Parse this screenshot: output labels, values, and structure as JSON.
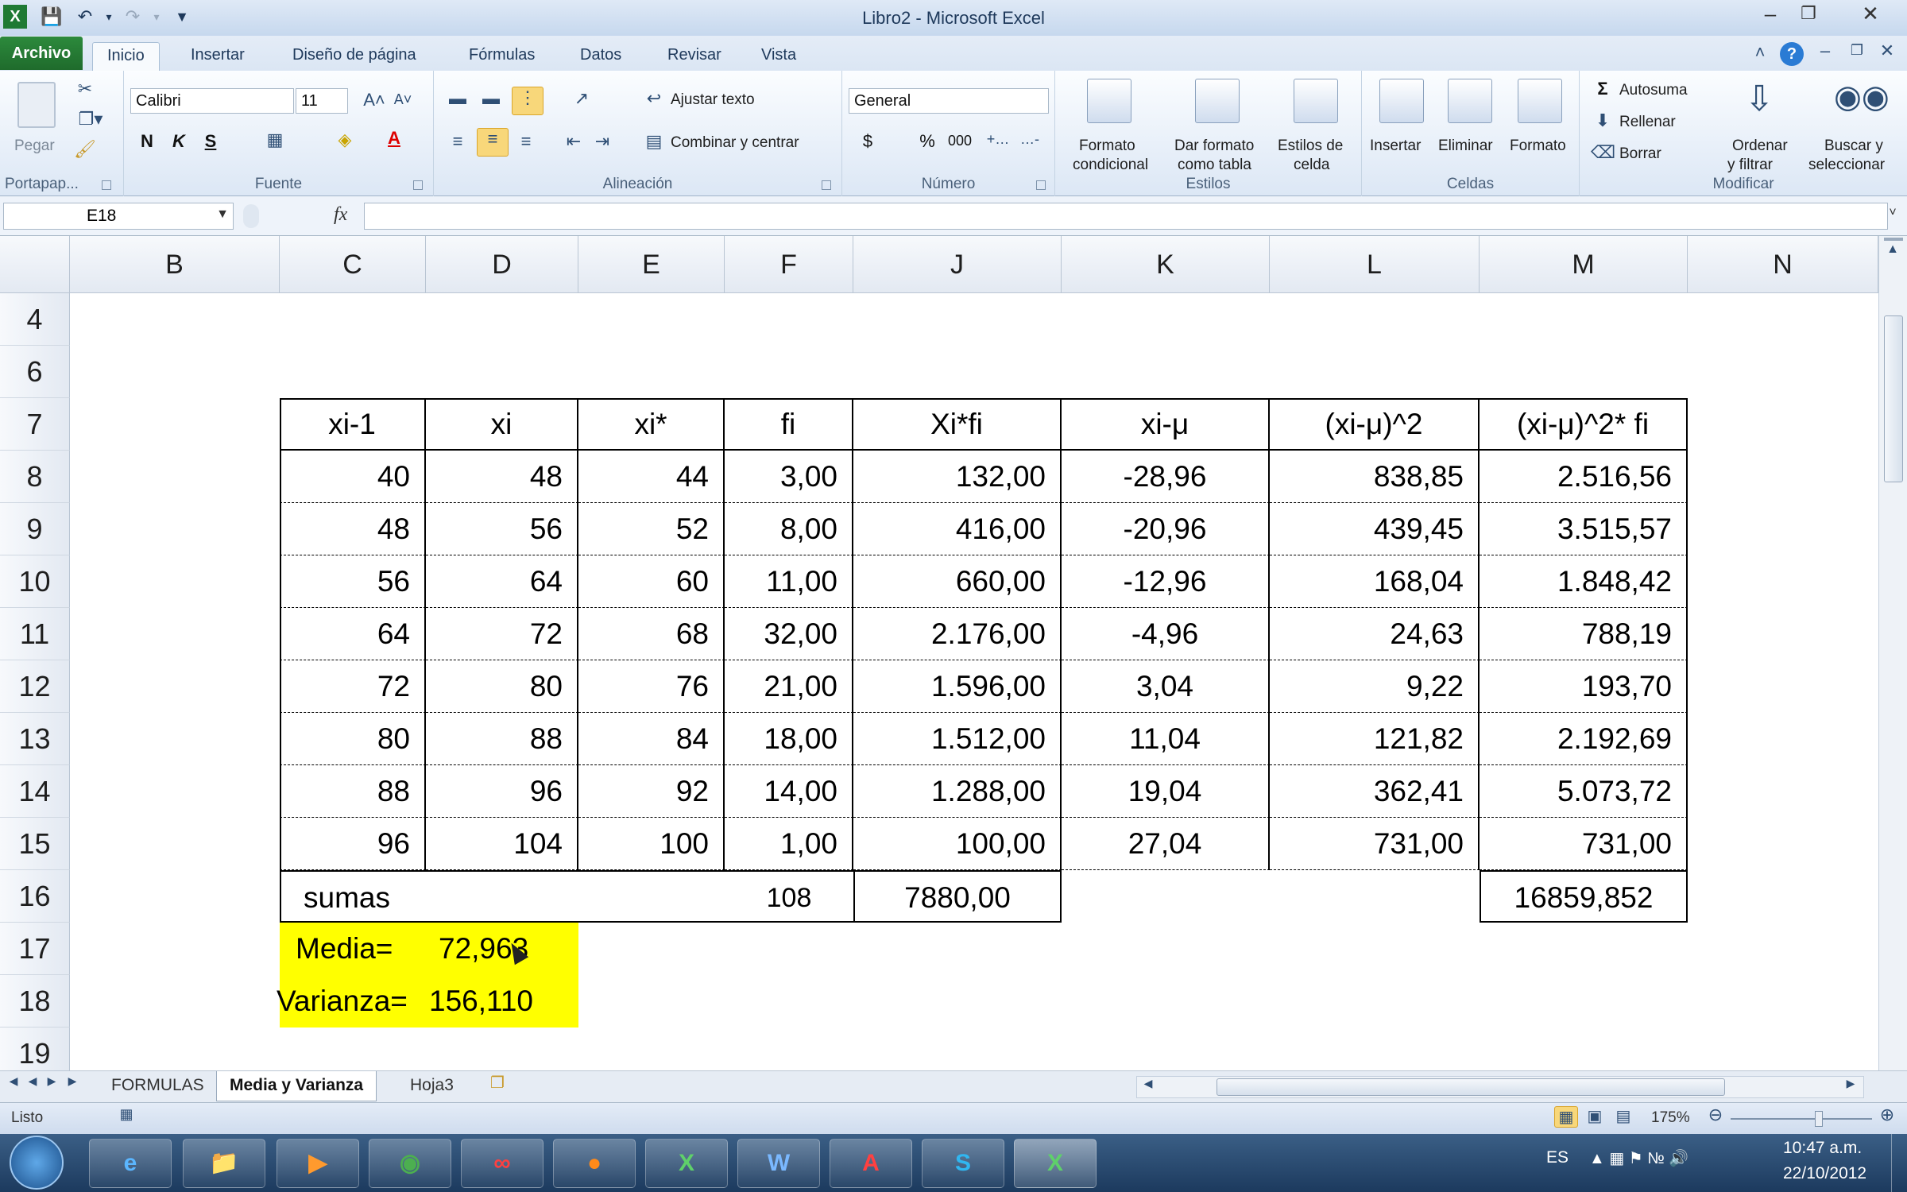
{
  "window": {
    "title": "Libro2  -  Microsoft Excel",
    "quick_access": [
      "save-icon",
      "undo-icon",
      "redo-icon",
      "customize-icon"
    ]
  },
  "menu_tabs": [
    "Archivo",
    "Inicio",
    "Insertar",
    "Diseño de página",
    "Fórmulas",
    "Datos",
    "Revisar",
    "Vista"
  ],
  "ribbon": {
    "clipboard": {
      "paste": "Pegar",
      "label": "Portapap..."
    },
    "font": {
      "name": "Calibri",
      "size": "11",
      "label": "Fuente",
      "bold": "N",
      "italic": "K",
      "underline": "S"
    },
    "alignment": {
      "wrap": "Ajustar texto",
      "merge": "Combinar y centrar",
      "label": "Alineación"
    },
    "number": {
      "format": "General",
      "currency": "$",
      "percent": "%",
      "thousands": "000",
      "label": "Número"
    },
    "styles": {
      "cond": [
        "Formato",
        "condicional"
      ],
      "table": [
        "Dar formato",
        "como tabla"
      ],
      "cell": [
        "Estilos de",
        "celda"
      ],
      "label": "Estilos"
    },
    "cells": {
      "insert": "Insertar",
      "delete": "Eliminar",
      "format": "Formato",
      "label": "Celdas"
    },
    "editing": {
      "autosum": "Autosuma",
      "fill": "Rellenar",
      "clear": "Borrar",
      "sort": [
        "Ordenar",
        "y filtrar"
      ],
      "find": [
        "Buscar y",
        "seleccionar"
      ],
      "label": "Modificar"
    }
  },
  "formula_bar": {
    "name_box": "E18",
    "fx": "fx",
    "formula": ""
  },
  "columns": [
    "B",
    "C",
    "D",
    "E",
    "F",
    "J",
    "K",
    "L",
    "M",
    "N"
  ],
  "rows": [
    "4",
    "6",
    "7",
    "8",
    "9",
    "10",
    "11",
    "12",
    "13",
    "14",
    "15",
    "16",
    "17",
    "18",
    "19"
  ],
  "table": {
    "headers": [
      "xi-1",
      "xi",
      "xi*",
      "fi",
      "Xi*fi",
      "xi-μ",
      "(xi-μ)^2",
      "(xi-μ)^2*    fi"
    ],
    "body": [
      [
        "40",
        "48",
        "44",
        "3,00",
        "132,00",
        "-28,96",
        "838,85",
        "2.516,56"
      ],
      [
        "48",
        "56",
        "52",
        "8,00",
        "416,00",
        "-20,96",
        "439,45",
        "3.515,57"
      ],
      [
        "56",
        "64",
        "60",
        "11,00",
        "660,00",
        "-12,96",
        "168,04",
        "1.848,42"
      ],
      [
        "64",
        "72",
        "68",
        "32,00",
        "2.176,00",
        "-4,96",
        "24,63",
        "788,19"
      ],
      [
        "72",
        "80",
        "76",
        "21,00",
        "1.596,00",
        "3,04",
        "9,22",
        "193,70"
      ],
      [
        "80",
        "88",
        "84",
        "18,00",
        "1.512,00",
        "11,04",
        "121,82",
        "2.192,69"
      ],
      [
        "88",
        "96",
        "92",
        "14,00",
        "1.288,00",
        "19,04",
        "362,41",
        "5.073,72"
      ],
      [
        "96",
        "104",
        "100",
        "1,00",
        "100,00",
        "27,04",
        "731,00",
        "731,00"
      ]
    ],
    "sums_label": "sumas",
    "sum_fi": "108",
    "sum_xifi": "7880,00",
    "sum_var": "16859,852"
  },
  "results": {
    "media_label": "Media=",
    "media_value": "72,963",
    "varianza_label": "Varianza=",
    "varianza_value": "156,110",
    "highlight_color": "#ffff00"
  },
  "sheets": [
    "FORMULAS",
    "Media y Varianza",
    "Hoja3"
  ],
  "status": {
    "ready": "Listo",
    "zoom": "175%"
  },
  "taskbar": {
    "apps": [
      "ie",
      "explorer",
      "media",
      "chrome",
      "acrobat-red",
      "firefox",
      "excel",
      "word",
      "acrobat",
      "skype",
      "excel-active"
    ],
    "lang": "ES",
    "time": "10:47 a.m.",
    "date": "22/10/2012"
  }
}
